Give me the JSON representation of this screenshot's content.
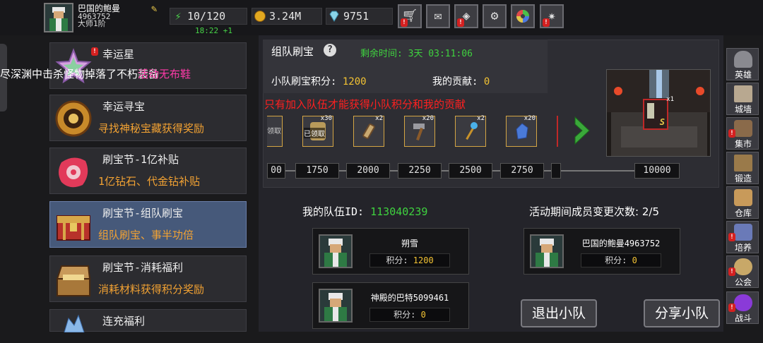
{
  "player": {
    "name": "巴国的鲍曼",
    "id": "4963752",
    "rank": "大师1阶"
  },
  "stats": {
    "energy": "10/120",
    "regen_timer": "18:22 +1",
    "gold": "3.24M",
    "diamonds": "9751"
  },
  "toolbar": [
    "shop-cart-icon",
    "mail-icon",
    "gamepad-icon",
    "gear-icon",
    "color-wheel-icon",
    "sparkle-icon"
  ],
  "marquee": {
    "text": "尽深渊中击杀怪物掉落了不朽装备",
    "overlap": "活动",
    "highlight": "无布鞋"
  },
  "activities": [
    {
      "title": "幸运星",
      "subtitle": ""
    },
    {
      "title": "幸运寻宝",
      "subtitle": "寻找神秘宝藏获得奖励"
    },
    {
      "title": "刷宝节-1亿补贴",
      "subtitle": "1亿钻石、代金钻补贴"
    },
    {
      "title": "刷宝节-组队刷宝",
      "subtitle": "组队刷宝、事半功倍"
    },
    {
      "title": "刷宝节-消耗福利",
      "subtitle": "消耗材料获得积分奖励"
    },
    {
      "title": "连充福利",
      "subtitle": ""
    }
  ],
  "event": {
    "title": "组队刷宝",
    "remaining_label": "剩余时间:",
    "remaining_value": "3天 03:11:06",
    "team_score_label": "小队刷宝积分:",
    "team_score": "1200",
    "contrib_label": "我的贡献:",
    "contrib": "0",
    "notice": "只有加入队伍才能获得小队积分和我的贡献",
    "claimed_1": "领取",
    "claimed_2": "已领取"
  },
  "rewards": [
    {
      "qty": "",
      "kind": "claimed"
    },
    {
      "qty": "x30",
      "kind": "claimed"
    },
    {
      "qty": "x2",
      "kind": "scroll"
    },
    {
      "qty": "x20",
      "kind": "hammer"
    },
    {
      "qty": "x2",
      "kind": "staff"
    },
    {
      "qty": "x20",
      "kind": "ore"
    }
  ],
  "thresholds": [
    "00",
    "1750",
    "2000",
    "2250",
    "2500",
    "2750",
    "10000"
  ],
  "scene_item": {
    "qty": "x1",
    "rarity": "S"
  },
  "team": {
    "id_label": "我的队伍ID:",
    "id": "113040239",
    "changes_label": "活动期间成员变更次数:",
    "changes": "2/5",
    "score_label": "积分:",
    "members": [
      {
        "name": "朔雪",
        "score": "1200"
      },
      {
        "name": "巴国的鲍曼4963752",
        "score": "0"
      },
      {
        "name": "神殿的巴特5099461",
        "score": "0"
      }
    ],
    "leave_button": "退出小队",
    "share_button": "分享小队"
  },
  "nav": [
    "英雄",
    "城墙",
    "集市",
    "锻造",
    "仓库",
    "培养",
    "公会",
    "战斗"
  ],
  "colors": {
    "accent_green": "#3fd23f",
    "accent_orange": "#f2a233",
    "alert_red": "#ff2020"
  }
}
